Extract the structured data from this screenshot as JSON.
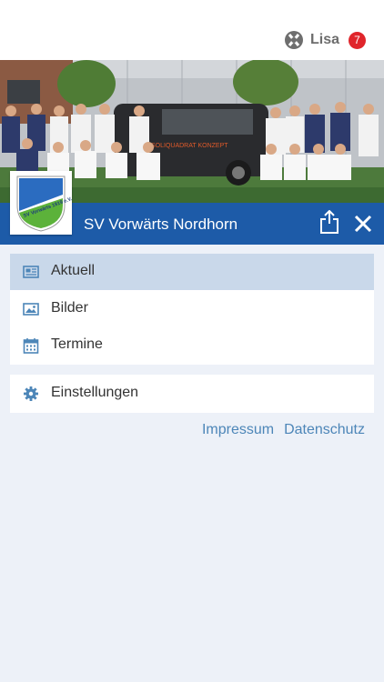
{
  "user": {
    "name": "Lisa",
    "notification_count": "7",
    "logo_icon": "app-logo-icon"
  },
  "club": {
    "name": "SV Vorwärts Nordhorn",
    "crest_text": "SV Vorwärts 1919 e.V.",
    "van_text": "SOLIQUADRAT KONZEPT",
    "colors": {
      "bar": "#1d5ba8",
      "crest_blue": "#2b6cc0",
      "crest_green": "#5cb23a"
    }
  },
  "menu": {
    "items": [
      {
        "label": "Aktuell",
        "icon": "newspaper-icon",
        "active": true
      },
      {
        "label": "Bilder",
        "icon": "image-icon",
        "active": false
      },
      {
        "label": "Termine",
        "icon": "calendar-icon",
        "active": false
      }
    ],
    "settings": {
      "label": "Einstellungen",
      "icon": "gear-icon"
    }
  },
  "footer": {
    "impressum": "Impressum",
    "datenschutz": "Datenschutz"
  }
}
